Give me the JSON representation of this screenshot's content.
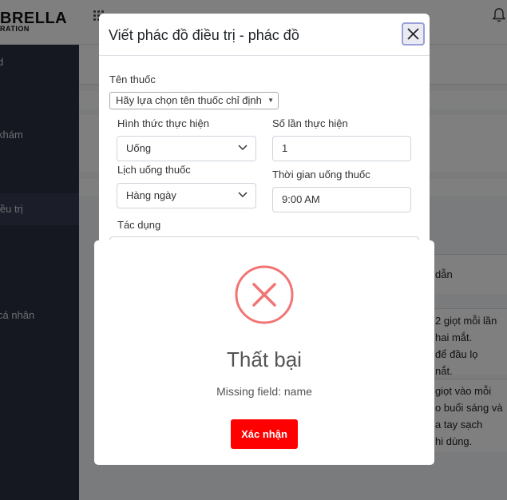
{
  "app": {
    "logo_line1": "BRELLA",
    "logo_line2": "RATION"
  },
  "sidebar": {
    "items": [
      {
        "label": "d"
      },
      {
        "label": "khám"
      },
      {
        "label": "iều trị"
      },
      {
        "label": "cá nhân"
      }
    ]
  },
  "background_content": {
    "lines": [
      "dẫn",
      "2 giọt mỗi lần",
      "hai mắt.",
      "để đầu lọ",
      "nắt.",
      "giọt vào mỗi",
      "o buổi sáng và",
      "a tay sạch",
      "hi dùng."
    ]
  },
  "modal": {
    "title": "Viết phác đồ điều trị - phác đồ",
    "drug_name_label": "Tên thuốc",
    "drug_name_select": "Hãy lựa chọn tên thuốc chỉ định",
    "method_label": "Hình thức thực hiện",
    "method_value": "Uống",
    "times_label": "Số lần thực hiện",
    "times_value": "1",
    "schedule_label": "Lịch uống thuốc",
    "schedule_value": "Hàng ngày",
    "time_label": "Thời gian uống thuốc",
    "time_value": "9:00 AM",
    "effect_label": "Tác dụng"
  },
  "alert": {
    "icon": "error-x-circle-icon",
    "title": "Thất bại",
    "message": "Missing field: name",
    "confirm_label": "Xác nhận",
    "colors": {
      "icon": "#f27474",
      "button": "#ff0000"
    }
  }
}
